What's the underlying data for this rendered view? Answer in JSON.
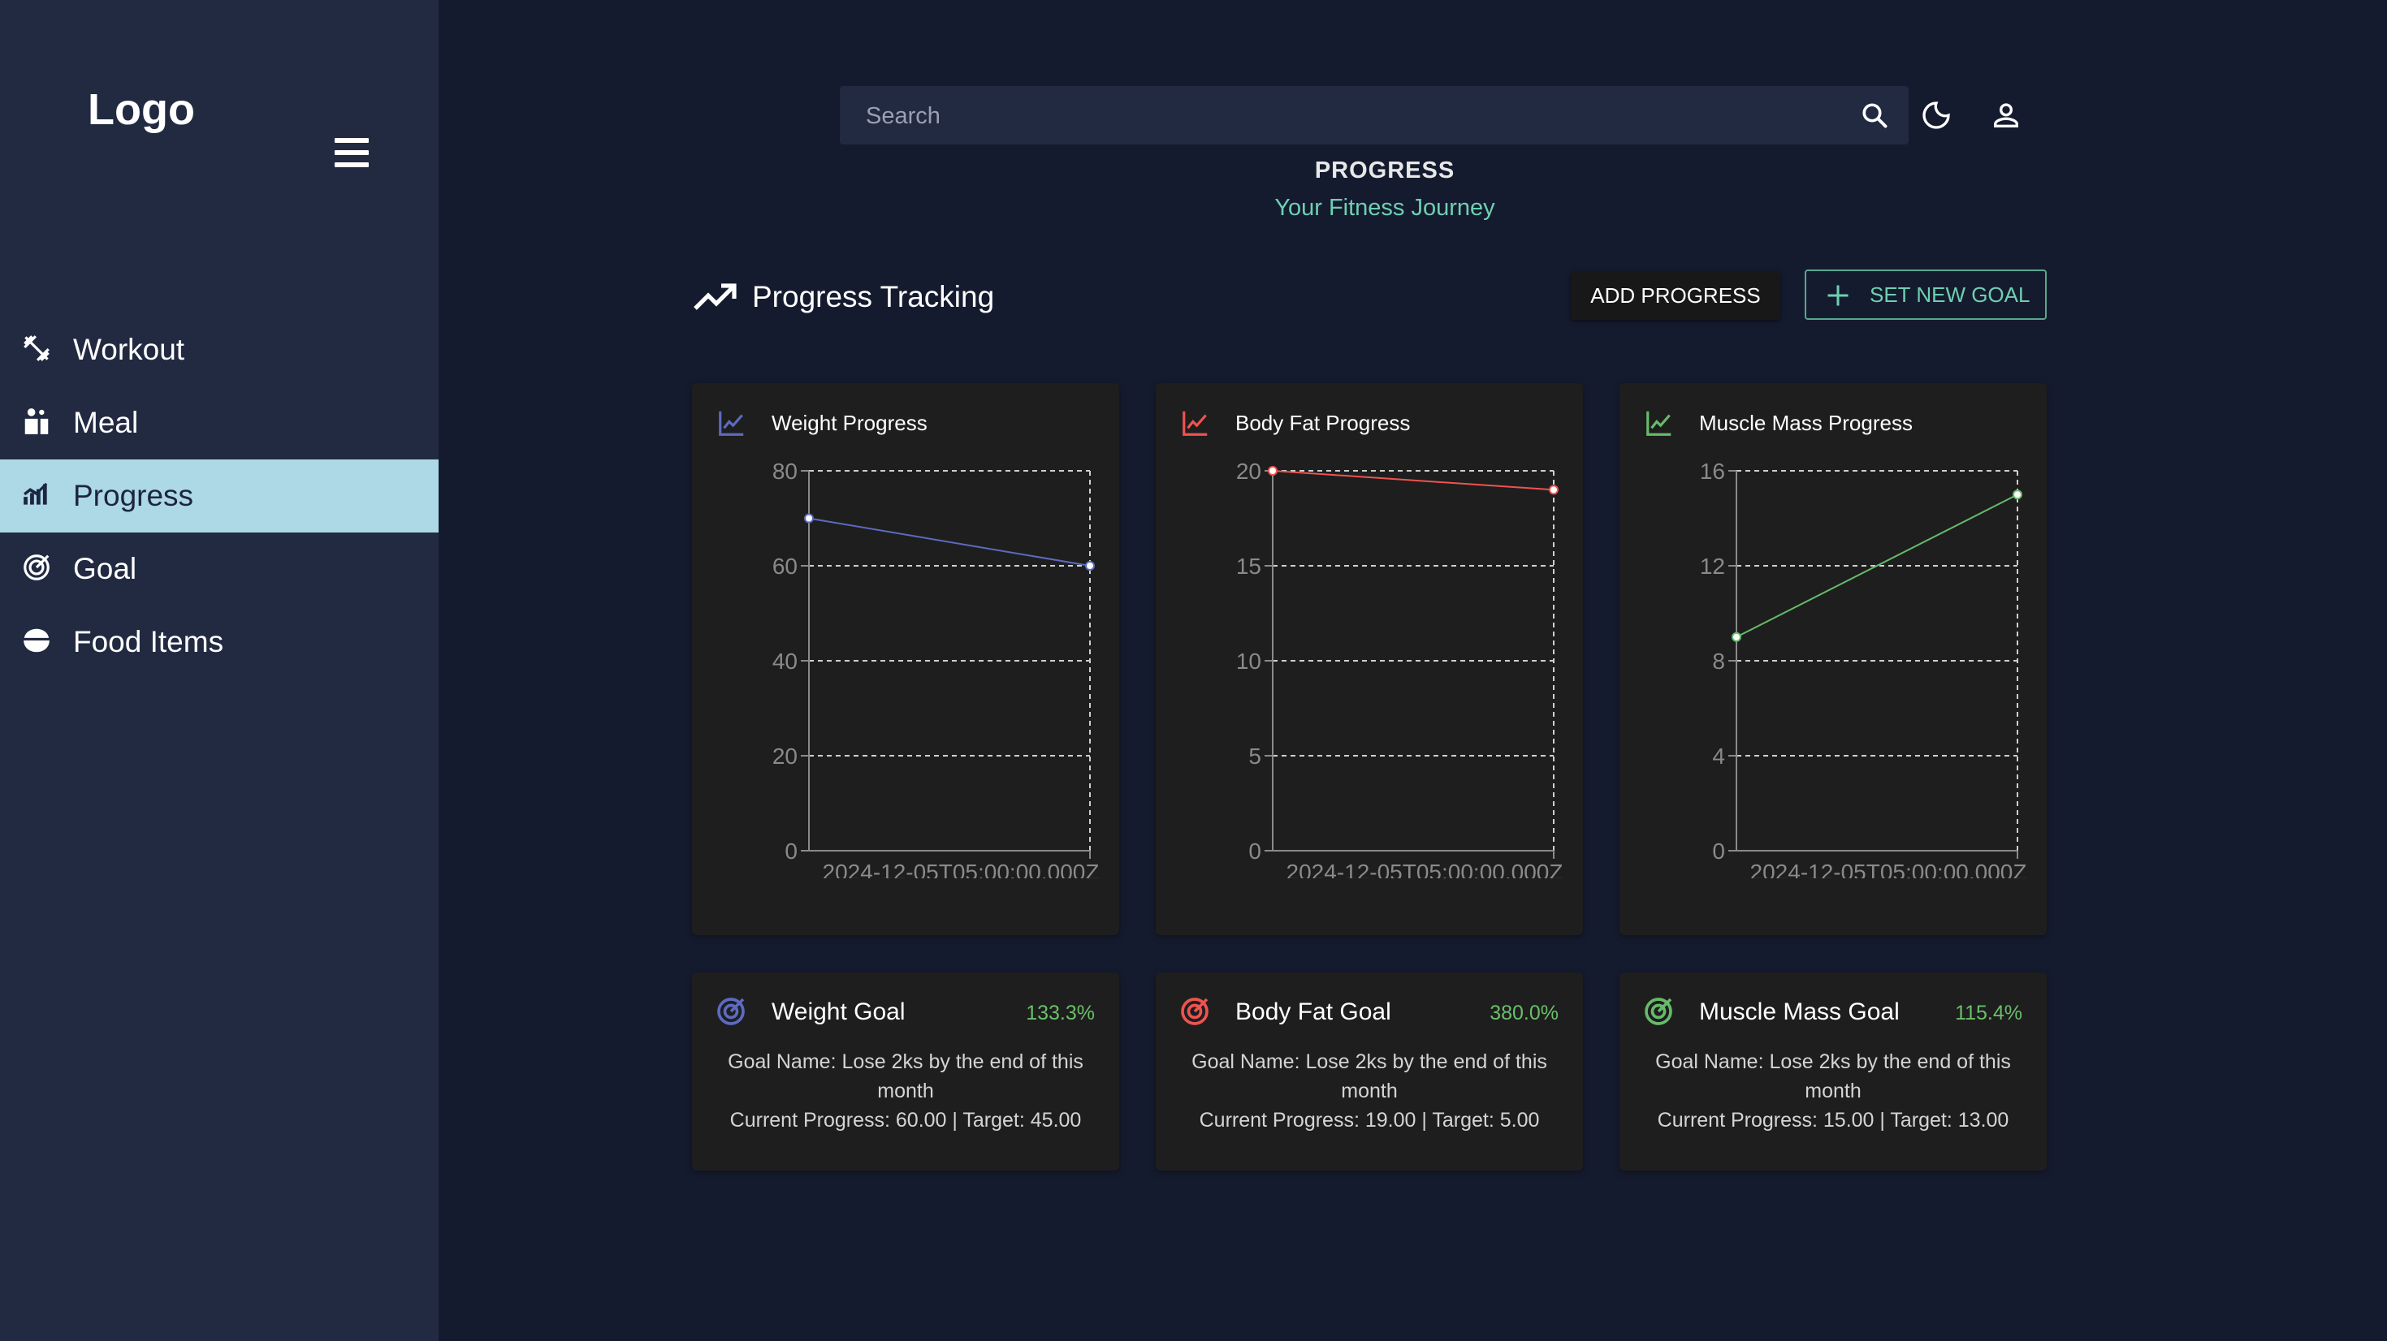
{
  "sidebar": {
    "logo": "Logo",
    "items": [
      {
        "label": "Workout",
        "icon": "dumbbell-icon",
        "active": false
      },
      {
        "label": "Meal",
        "icon": "meal-icon",
        "active": false
      },
      {
        "label": "Progress",
        "icon": "bar-chart-icon",
        "active": true
      },
      {
        "label": "Goal",
        "icon": "target-icon",
        "active": false
      },
      {
        "label": "Food Items",
        "icon": "rice-bowl-icon",
        "active": false
      }
    ]
  },
  "header": {
    "search_placeholder": "Search",
    "search_value": ""
  },
  "page": {
    "title": "PROGRESS",
    "subtitle": "Your Fitness Journey"
  },
  "section": {
    "title": "Progress Tracking",
    "add_progress_label": "ADD PROGRESS",
    "set_goal_label": "SET NEW GOAL"
  },
  "colors": {
    "accent_teal": "#6fcfb2",
    "active_nav": "#add8e6",
    "weight": "#5c6bc0",
    "bodyfat": "#ef5350",
    "muscle": "#66bb6a"
  },
  "chart_data": [
    {
      "type": "line",
      "title": "Weight Progress",
      "color": "#5c6bc0",
      "x_tick_label": "2024-12-05T05:00:00.000Z",
      "y_ticks": [
        0,
        20,
        40,
        60,
        80
      ],
      "ylim": [
        0,
        80
      ],
      "values": [
        70,
        60
      ],
      "grid": true
    },
    {
      "type": "line",
      "title": "Body Fat Progress",
      "color": "#ef5350",
      "x_tick_label": "2024-12-05T05:00:00.000Z",
      "y_ticks": [
        0,
        5,
        10,
        15,
        20
      ],
      "ylim": [
        0,
        20
      ],
      "values": [
        20,
        19
      ],
      "grid": true
    },
    {
      "type": "line",
      "title": "Muscle Mass Progress",
      "color": "#66bb6a",
      "x_tick_label": "2024-12-05T05:00:00.000Z",
      "y_ticks": [
        0,
        4,
        8,
        12,
        16
      ],
      "ylim": [
        0,
        16
      ],
      "values": [
        9,
        15
      ],
      "grid": true
    }
  ],
  "goals": [
    {
      "title": "Weight Goal",
      "percent": "133.3%",
      "name_line": "Goal Name: Lose 2ks by the end of this month",
      "progress_line": "Current Progress: 60.00 | Target: 45.00",
      "color": "#5c6bc0"
    },
    {
      "title": "Body Fat Goal",
      "percent": "380.0%",
      "name_line": "Goal Name: Lose 2ks by the end of this month",
      "progress_line": "Current Progress: 19.00 | Target: 5.00",
      "color": "#ef5350"
    },
    {
      "title": "Muscle Mass Goal",
      "percent": "115.4%",
      "name_line": "Goal Name: Lose 2ks by the end of this month",
      "progress_line": "Current Progress: 15.00 | Target: 13.00",
      "color": "#66bb6a"
    }
  ]
}
